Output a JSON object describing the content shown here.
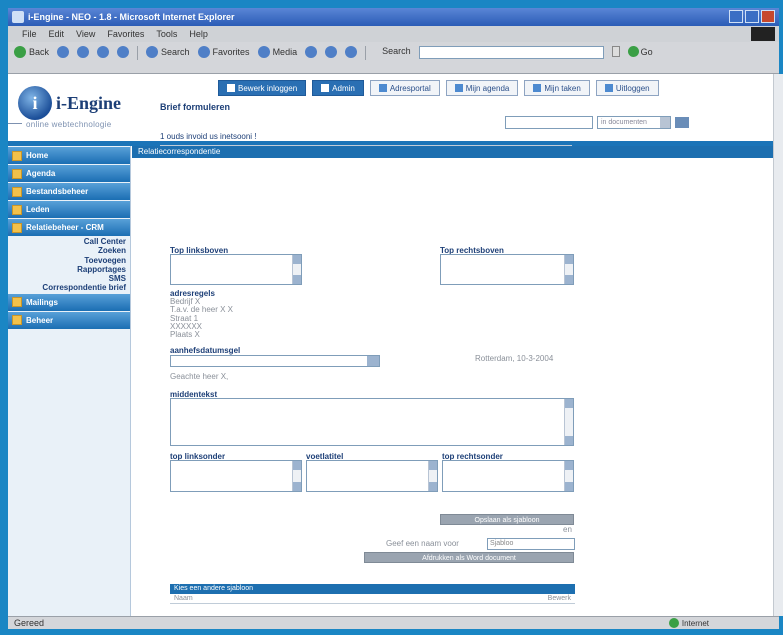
{
  "window": {
    "title": "i-Engine - NEO - 1.8 - Microsoft Internet Explorer"
  },
  "menu": [
    "File",
    "Edit",
    "View",
    "Favorites",
    "Tools",
    "Help"
  ],
  "toolbar": {
    "back": "Back",
    "search": "Search",
    "favorites": "Favorites",
    "media": "Media",
    "address_label": "Search",
    "go": "Go"
  },
  "brand": {
    "mark": "i",
    "name": "i-Engine",
    "tagline": "online webtechnologie"
  },
  "topnav": [
    {
      "label": "Bewerk inloggen",
      "active": true
    },
    {
      "label": "Admin",
      "active": true
    },
    {
      "label": "Adresportal",
      "active": false
    },
    {
      "label": "Mijn agenda",
      "active": false
    },
    {
      "label": "Mijn taken",
      "active": false
    },
    {
      "label": "Uitloggen",
      "active": false
    }
  ],
  "search": {
    "scope": "in documenten"
  },
  "sidebar": {
    "items": [
      {
        "label": "Home"
      },
      {
        "label": "Agenda"
      },
      {
        "label": "Bestandsbeheer"
      },
      {
        "label": "Leden"
      },
      {
        "label": "Relatiebeheer - CRM"
      }
    ],
    "subitems": [
      "Call Center",
      "Zoeken",
      "Toevoegen",
      "Rapportages",
      "SMS",
      "Correspondentie brief"
    ],
    "items2": [
      {
        "label": "Mailings"
      },
      {
        "label": "Beheer"
      }
    ]
  },
  "section": {
    "title": "Relatiecorrespondentie"
  },
  "form": {
    "title": "Brief formuleren",
    "step": "1 ouds invoid us inetsooni !",
    "top_left_label": "Top linksboven",
    "top_right_label": "Top rechtsboven",
    "address_label": "adresregels",
    "address_lines": [
      "Bedrijf X",
      "T.a.v. de heer X X",
      "Straat 1",
      "XXXXXX",
      "Plaats X"
    ],
    "salutation_label": "aanhefsdatumsgel",
    "date_text": "Rotterdam, 10-3-2004",
    "salutation_text": "Geachte heer X,",
    "body_label": "middentekst",
    "bottom_left_label": "top linksonder",
    "bottom_middle_label": "voetlatitel",
    "bottom_right_label": "top rechtsonder",
    "save_button": "Opslaan als sjabloon",
    "sjabloon_suffix": "en",
    "name_label": "Geef een naam voor",
    "name_value": "Sjabloo",
    "preview_button": "Afdrukken als Word document"
  },
  "bottom_table": {
    "header": "Kies een andere sjabloon",
    "col_left": "Naam",
    "col_right": "Bewerk"
  },
  "status": {
    "left": "Gereed",
    "zone": "Internet"
  }
}
